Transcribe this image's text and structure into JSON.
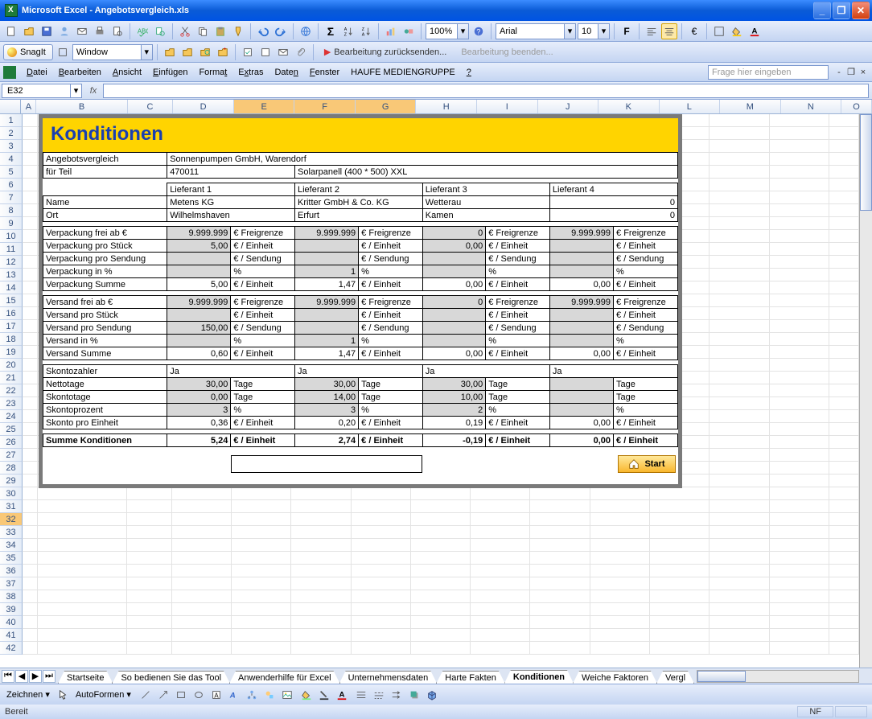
{
  "app": {
    "title": "Microsoft Excel - Angebotsvergleich.xls"
  },
  "toolbar": {
    "zoom": "100%",
    "font_name": "Arial",
    "font_size": "10",
    "snagit": "SnagIt",
    "snagit_mode": "Window",
    "review_send": "Bearbeitung zurücksenden...",
    "review_end": "Bearbeitung beenden..."
  },
  "menu": {
    "items": [
      "Datei",
      "Bearbeiten",
      "Ansicht",
      "Einfügen",
      "Format",
      "Extras",
      "Daten",
      "Fenster",
      "HAUFE MEDIENGRUPPE",
      "?"
    ],
    "ask_placeholder": "Frage hier eingeben"
  },
  "formula": {
    "cell_ref": "E32",
    "fx": "fx",
    "value": ""
  },
  "columns": [
    "A",
    "B",
    "C",
    "D",
    "E",
    "F",
    "G",
    "H",
    "I",
    "J",
    "K",
    "L",
    "M",
    "N",
    "O"
  ],
  "rows_first": 1,
  "rows_count": 42,
  "selected_row": 32,
  "sheet": {
    "title": "Konditionen",
    "header1_label": "Angebotsvergleich",
    "header1_value": "Sonnenpumpen GmbH, Warendorf",
    "header2_label": "für Teil",
    "header2_part": "470011",
    "header2_desc": "Solarpanell (400 * 500) XXL",
    "supplier_labels": [
      "Lieferant 1",
      "Lieferant 2",
      "Lieferant 3",
      "Lieferant 4"
    ],
    "name_label": "Name",
    "names": [
      "Metens KG",
      "Kritter GmbH & Co. KG",
      "Wetterau",
      "0"
    ],
    "ort_label": "Ort",
    "orts": [
      "Wilhelmshaven",
      "Erfurt",
      "Kamen",
      "0"
    ],
    "rows_pack": [
      {
        "label": "Verpackung frei ab €",
        "unit": "€ Freigrenze",
        "v": [
          "9.999.999",
          "9.999.999",
          "0",
          "9.999.999"
        ]
      },
      {
        "label": "Verpackung pro Stück",
        "unit": "€ / Einheit",
        "v": [
          "5,00",
          "",
          "0,00",
          ""
        ]
      },
      {
        "label": "Verpackung pro Sendung",
        "unit": "€ / Sendung",
        "v": [
          "",
          "",
          "",
          ""
        ]
      },
      {
        "label": "Verpackung in %",
        "unit": "%",
        "v": [
          "",
          "1",
          "",
          ""
        ]
      },
      {
        "label": "Verpackung Summe",
        "unit": "€ / Einheit",
        "v": [
          "5,00",
          "1,47",
          "0,00",
          "0,00"
        ],
        "calc": true
      }
    ],
    "rows_ship": [
      {
        "label": "Versand frei ab €",
        "unit": "€ Freigrenze",
        "v": [
          "9.999.999",
          "9.999.999",
          "0",
          "9.999.999"
        ]
      },
      {
        "label": "Versand pro Stück",
        "unit": "€ / Einheit",
        "v": [
          "",
          "",
          "",
          ""
        ]
      },
      {
        "label": "Versand pro Sendung",
        "unit": "€ / Sendung",
        "v": [
          "150,00",
          "",
          "",
          ""
        ]
      },
      {
        "label": "Versand in %",
        "unit": "%",
        "v": [
          "",
          "1",
          "",
          ""
        ]
      },
      {
        "label": "Versand Summe",
        "unit": "€ / Einheit",
        "v": [
          "0,60",
          "1,47",
          "0,00",
          "0,00"
        ],
        "calc": true
      }
    ],
    "skonto_label": "Skontozahler",
    "skonto_values": [
      "Ja",
      "Ja",
      "Ja",
      "Ja"
    ],
    "rows_skonto": [
      {
        "label": "Nettotage",
        "unit": "Tage",
        "v": [
          "30,00",
          "30,00",
          "30,00",
          ""
        ]
      },
      {
        "label": "Skontotage",
        "unit": "Tage",
        "v": [
          "0,00",
          "14,00",
          "10,00",
          ""
        ]
      },
      {
        "label": "Skontoprozent",
        "unit": "%",
        "v": [
          "3",
          "3",
          "2",
          ""
        ]
      },
      {
        "label": "Skonto pro Einheit",
        "unit": "€ / Einheit",
        "v": [
          "0,36",
          "0,20",
          "0,19",
          "0,00"
        ],
        "calc": true
      }
    ],
    "total_label": "Summe Konditionen",
    "total_unit": "€ / Einheit",
    "totals": [
      "5,24",
      "2,74",
      "-0,19",
      "0,00"
    ],
    "start_btn": "Start"
  },
  "tabs": {
    "items": [
      "Startseite",
      "So bedienen Sie das Tool",
      "Anwenderhilfe für Excel",
      "Unternehmensdaten",
      "Harte Fakten",
      "Konditionen",
      "Weiche Faktoren",
      "Vergl"
    ],
    "active": 5
  },
  "drawbar": {
    "zeichnen": "Zeichnen",
    "autoformen": "AutoFormen"
  },
  "status": {
    "ready": "Bereit",
    "nf": "NF"
  }
}
